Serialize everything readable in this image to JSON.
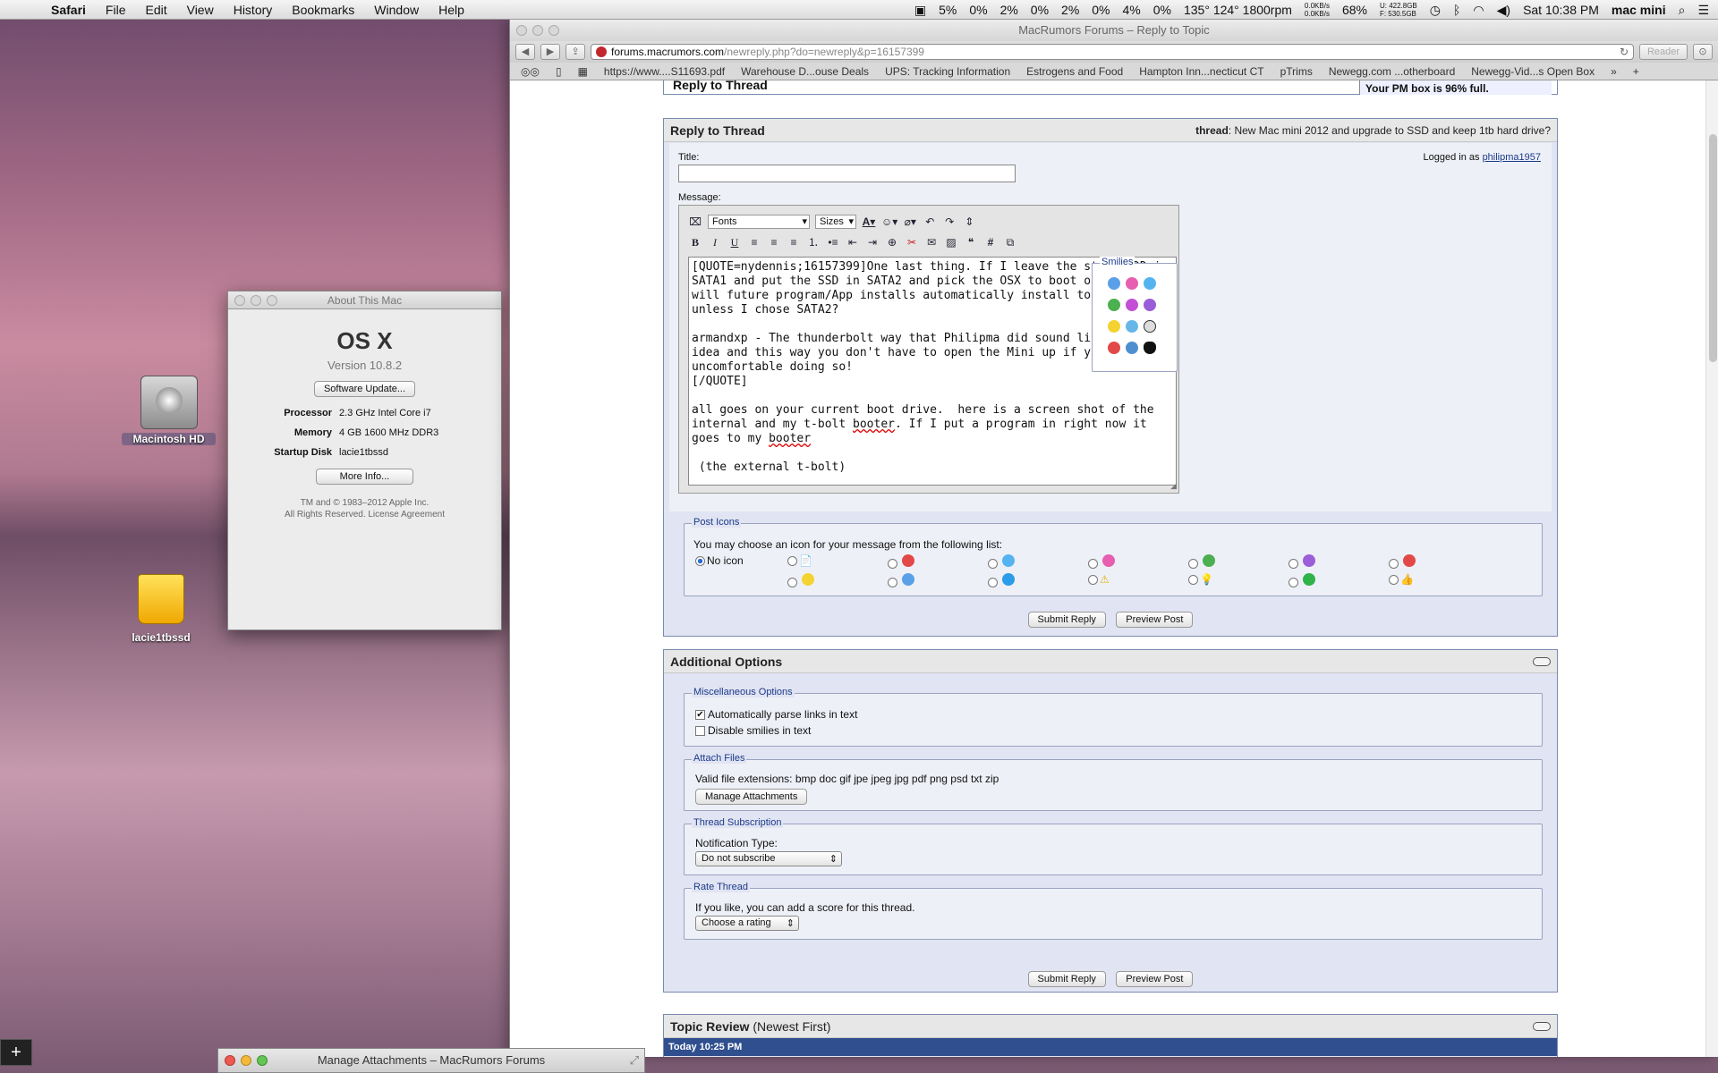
{
  "menubar": {
    "app": "Safari",
    "items": [
      "File",
      "Edit",
      "View",
      "History",
      "Bookmarks",
      "Window",
      "Help"
    ],
    "status": {
      "cpu": [
        "5%",
        "0%",
        "2%",
        "0%",
        "2%",
        "0%",
        "4%",
        "0%"
      ],
      "temps": "135° 124° 1800rpm",
      "net_up": "0.0KB/s",
      "net_down": "0.0KB/s",
      "battery": "68%",
      "disk_u": "U: 422.8GB",
      "disk_f": "F: 530.5GB",
      "clock": "Sat 10:38 PM",
      "hostname": "mac mini"
    }
  },
  "desktop": {
    "icons": [
      {
        "label": "Macintosh HD"
      },
      {
        "label": "lacie1tbssd"
      }
    ]
  },
  "about": {
    "title": "About This Mac",
    "os": "OS X",
    "version": "Version 10.8.2",
    "update_button": "Software Update...",
    "specs": [
      {
        "k": "Processor",
        "v": "2.3 GHz Intel Core i7"
      },
      {
        "k": "Memory",
        "v": "4 GB 1600 MHz DDR3"
      },
      {
        "k": "Startup Disk",
        "v": "lacie1tbssd"
      }
    ],
    "more_button": "More Info...",
    "copyright": "TM and © 1983–2012 Apple Inc.",
    "rights": "All Rights Reserved.",
    "license": "License Agreement"
  },
  "safari": {
    "title": "MacRumors Forums – Reply to Topic",
    "url_host": "forums.macrumors.com",
    "url_path": "/newreply.php?do=newreply&p=16157399",
    "reader": "Reader",
    "bookmarks": [
      "https://www....S11693.pdf",
      "Warehouse D...ouse Deals",
      "UPS: Tracking Information",
      "Estrogens and Food",
      "Hampton Inn...necticut CT",
      "pTrims",
      "Newegg.com ...otherboard",
      "Newegg-Vid...s Open Box"
    ]
  },
  "page": {
    "prev_header": "Reply to Thread",
    "pm_notice": "Your PM box is 96% full.",
    "reply": {
      "heading": "Reply to Thread",
      "thread_label": "thread",
      "thread_title": ": New Mac mini 2012 and upgrade to SSD and keep 1tb hard drive?",
      "title_label": "Title:",
      "logged_in": "Logged in as ",
      "username": "philipma1957",
      "message_label": "Message:",
      "fonts": "Fonts",
      "sizes": "Sizes",
      "message_p1": "[QUOTE=nydennis;16157399]One last thing. If I leave the stock HDD in SATA1 and put the SSD in SATA2 and pick the OSX to boot off SATA2 will future program/App installs automatically install to SATA1 unless I chose SATA2?\n\narmandxp - The thunderbolt way that Philipma did sound like a great idea and this way you don't have to open the Mini up if your uncomfortable doing so!\n[/QUOTE]\n\nall goes on your current boot drive.  here is a screen shot of the internal and my t-bolt ",
      "message_w1": "booter",
      "message_p2": ". If I put a program in right now it goes to my ",
      "message_w2": "booter",
      "message_p3": "\n\n (the external t-bolt)",
      "smilies_legend": "Smilies",
      "post_icons_legend": "Post Icons",
      "post_icons_text": "You may choose an icon for your message from the following list:",
      "no_icon": "No icon",
      "submit": "Submit Reply",
      "preview": "Preview Post"
    },
    "options": {
      "heading": "Additional Options",
      "misc_legend": "Miscellaneous Options",
      "parse_links": "Automatically parse links in text",
      "disable_smilies": "Disable smilies in text",
      "attach_legend": "Attach Files",
      "valid_ext": "Valid file extensions: bmp doc gif jpe jpeg jpg pdf png psd txt zip",
      "manage": "Manage Attachments",
      "sub_legend": "Thread Subscription",
      "notif_label": "Notification Type:",
      "notif_value": "Do not subscribe",
      "rate_legend": "Rate Thread",
      "rate_text": "If you like, you can add a score for this thread.",
      "rate_value": "Choose a rating",
      "submit": "Submit Reply",
      "preview": "Preview Post"
    },
    "review": {
      "heading": "Topic Review",
      "sub": "(Newest First)",
      "time": "Today 10:25 PM"
    }
  },
  "manage_window": {
    "title": "Manage Attachments – MacRumors Forums"
  },
  "colors": {
    "accent": "#1b3a8a",
    "review_bar": "#2f4f8f"
  }
}
